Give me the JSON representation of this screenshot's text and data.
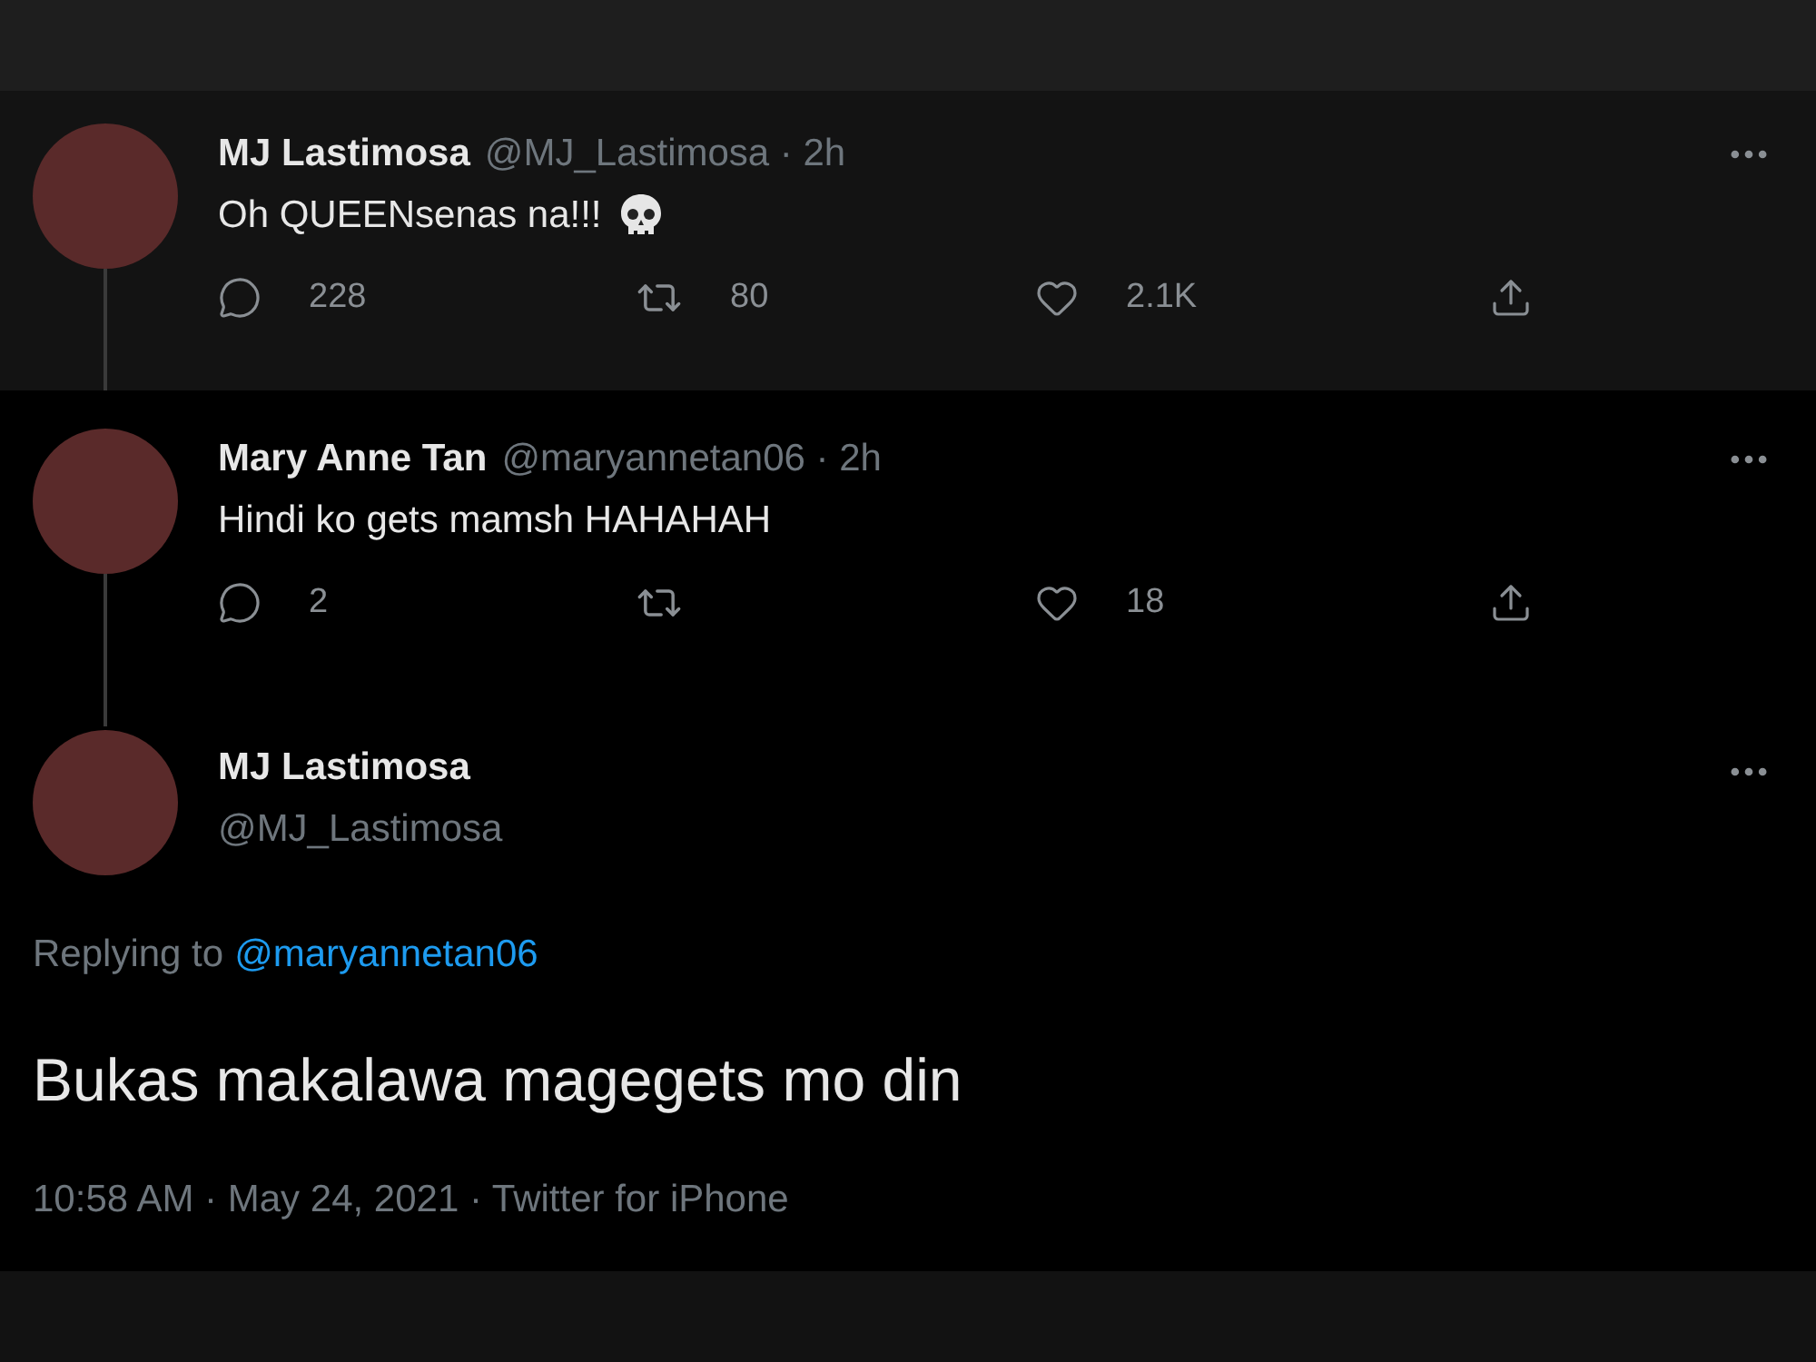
{
  "thread": [
    {
      "name": "MJ Lastimosa",
      "meta": "@MJ_Lastimosa · 2h",
      "text": "Oh QUEENsenas na!!!",
      "skull": true,
      "highlight": true,
      "actions": [
        {
          "kind": "reply",
          "count": "228"
        },
        {
          "kind": "retweet",
          "count": "80"
        },
        {
          "kind": "like",
          "count": "2.1K"
        },
        {
          "kind": "share"
        }
      ]
    },
    {
      "name": "Mary Anne Tan",
      "meta": "@maryannetan06 · 2h",
      "text": "Hindi ko gets mamsh HAHAHAH",
      "skull": false,
      "highlight": false,
      "actions": [
        {
          "kind": "reply",
          "count": "2"
        },
        {
          "kind": "retweet"
        },
        {
          "kind": "like",
          "count": "18"
        },
        {
          "kind": "share"
        }
      ]
    }
  ],
  "main_tweet": {
    "name": "MJ Lastimosa",
    "handle": "@MJ_Lastimosa",
    "replying_label": "Replying to",
    "replying_handle": "@maryannetan06",
    "text": "Bukas makalawa magegets mo din",
    "footer": "10:58 AM · May 24, 2021 · Twitter for iPhone"
  }
}
